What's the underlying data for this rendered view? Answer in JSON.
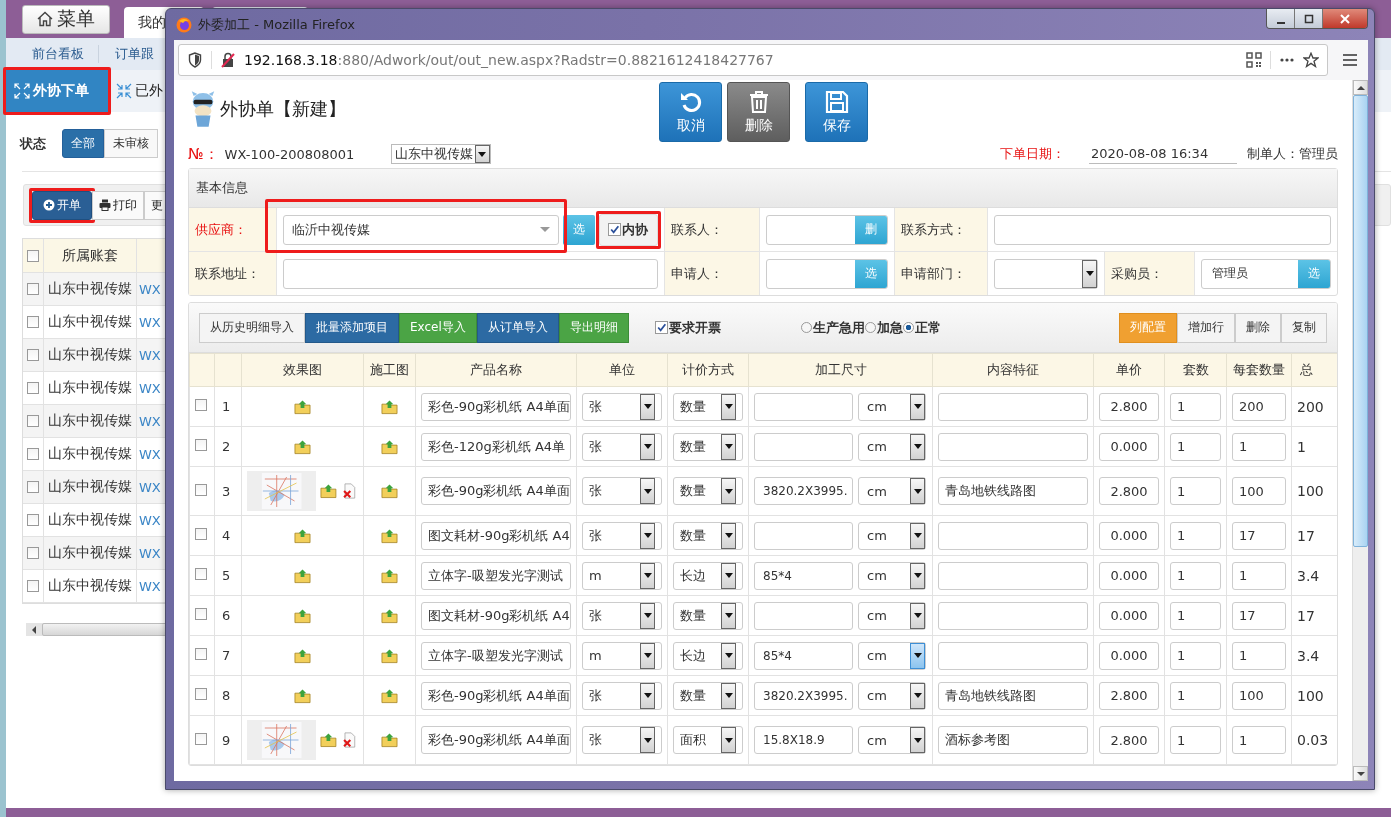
{
  "background_app": {
    "menu_button": "菜单",
    "tabs": [
      {
        "label": "我的",
        "selected": true
      }
    ],
    "nav": [
      "前台看板",
      "订单跟"
    ],
    "subtabs": [
      {
        "label": "外协下单",
        "kind": "expand",
        "selected": true,
        "highlighted": true
      },
      {
        "label": "已外",
        "kind": "collapse",
        "selected": false,
        "highlighted": false
      }
    ],
    "status_filter": {
      "label": "状态",
      "options": [
        {
          "label": "全部",
          "selected": true
        },
        {
          "label": "未审核",
          "selected": false
        }
      ]
    },
    "toolbar": [
      {
        "label": "开单",
        "kind": "add",
        "highlighted": true
      },
      {
        "label": "打印",
        "kind": "print",
        "highlighted": false
      },
      {
        "label": "更",
        "kind": "plain",
        "highlighted": false
      }
    ],
    "table": {
      "all_checked": false,
      "columns": [
        "所属账套"
      ],
      "rows": [
        {
          "checked": false,
          "account": "山东中视传媒",
          "number": "WX"
        },
        {
          "checked": false,
          "account": "山东中视传媒",
          "number": "WX"
        },
        {
          "checked": false,
          "account": "山东中视传媒",
          "number": "WX"
        },
        {
          "checked": false,
          "account": "山东中视传媒",
          "number": "WX"
        },
        {
          "checked": false,
          "account": "山东中视传媒",
          "number": "WX"
        },
        {
          "checked": false,
          "account": "山东中视传媒",
          "number": "WX"
        },
        {
          "checked": false,
          "account": "山东中视传媒",
          "number": "WX"
        },
        {
          "checked": false,
          "account": "山东中视传媒",
          "number": "WX"
        },
        {
          "checked": false,
          "account": "山东中视传媒",
          "number": "WX"
        },
        {
          "checked": false,
          "account": "山东中视传媒",
          "number": "WX"
        }
      ]
    }
  },
  "popup": {
    "window_title": "外委加工 - Mozilla Firefox",
    "url_host": "192.168.3.18",
    "url_rest": ":880/Adwork/out/out_new.aspx?Radstr=0.8821612418427767",
    "page_title": "外协单【新建】",
    "actions": [
      {
        "label": "取消",
        "kind": "cancel"
      },
      {
        "label": "删除",
        "kind": "delete"
      },
      {
        "label": "保存",
        "kind": "save"
      }
    ],
    "order_no_label": "№：",
    "order_no": "WX-100-200808001",
    "account_select": "山东中视传媒",
    "date_label": "下单日期：",
    "date": "2020-08-08 16:34",
    "creator": "制单人：管理员",
    "basic_info": {
      "title": "基本信息",
      "supplier_label": "供应商：",
      "supplier": "临沂中视传媒",
      "supplier_highlighted": true,
      "supplier_button": "选",
      "internal": {
        "label": "内协",
        "checked": true,
        "highlighted": true
      },
      "contact_label": "联系人：",
      "contact_button": "删",
      "contact_method_label": "联系方式：",
      "address_label": "联系地址：",
      "applicant_label": "申请人：",
      "applicant_button": "选",
      "dept_label": "申请部门：",
      "buyer_label": "采购员：",
      "buyer": "管理员",
      "buyer_button": "选"
    },
    "imports": [
      {
        "label": "从历史明细导入",
        "kind": "plain"
      },
      {
        "label": "批量添加项目",
        "kind": "blue"
      },
      {
        "label": "Excel导入",
        "kind": "green"
      },
      {
        "label": "从订单导入",
        "kind": "blue"
      },
      {
        "label": "导出明细",
        "kind": "green"
      }
    ],
    "invoice": {
      "label": "要求开票",
      "checked": true
    },
    "urgency": [
      {
        "label": "生产急用",
        "selected": false
      },
      {
        "label": "加急",
        "selected": false
      },
      {
        "label": "正常",
        "selected": true
      }
    ],
    "grid_actions": [
      {
        "label": "列配置",
        "kind": "orange"
      },
      {
        "label": "增加行",
        "kind": "plain"
      },
      {
        "label": "删除",
        "kind": "plain"
      },
      {
        "label": "复制",
        "kind": "plain"
      }
    ],
    "columns": [
      "效果图",
      "施工图",
      "产品名称",
      "单位",
      "计价方式",
      "加工尺寸",
      "内容特征",
      "单价",
      "套数",
      "每套数量",
      "总"
    ],
    "rows": [
      {
        "checked": false,
        "no": "1",
        "has_image": false,
        "name": "彩色-90g彩机纸 A4单面",
        "unit": "张",
        "pricing": "数量",
        "size_unit": "cm",
        "size_unit_focused": false,
        "price": "2.800",
        "sets": "1",
        "per_set": "200",
        "total": "200"
      },
      {
        "checked": false,
        "no": "2",
        "has_image": false,
        "name": "彩色-120g彩机纸 A4单",
        "unit": "张",
        "pricing": "数量",
        "size_unit": "cm",
        "size_unit_focused": false,
        "price": "0.000",
        "sets": "1",
        "per_set": "1",
        "total": "1"
      },
      {
        "checked": false,
        "no": "3",
        "has_image": true,
        "name": "彩色-90g彩机纸 A4单面",
        "unit": "张",
        "pricing": "数量",
        "size": "3820.2X3995.",
        "size_unit": "cm",
        "size_unit_focused": false,
        "feature": "青岛地铁线路图",
        "price": "2.800",
        "sets": "1",
        "per_set": "100",
        "total": "100"
      },
      {
        "checked": false,
        "no": "4",
        "has_image": false,
        "name": "图文耗材-90g彩机纸 A4",
        "unit": "张",
        "pricing": "数量",
        "size_unit": "cm",
        "size_unit_focused": false,
        "price": "0.000",
        "sets": "1",
        "per_set": "17",
        "total": "17"
      },
      {
        "checked": false,
        "no": "5",
        "has_image": false,
        "name": "立体字-吸塑发光字测试",
        "unit": "m",
        "pricing": "长边",
        "size": "85*4",
        "size_unit": "cm",
        "size_unit_focused": false,
        "price": "0.000",
        "sets": "1",
        "per_set": "1",
        "total": "3.4"
      },
      {
        "checked": false,
        "no": "6",
        "has_image": false,
        "name": "图文耗材-90g彩机纸 A4",
        "unit": "张",
        "pricing": "数量",
        "size_unit": "cm",
        "size_unit_focused": false,
        "price": "0.000",
        "sets": "1",
        "per_set": "17",
        "total": "17"
      },
      {
        "checked": false,
        "no": "7",
        "has_image": false,
        "name": "立体字-吸塑发光字测试",
        "unit": "m",
        "pricing": "长边",
        "size": "85*4",
        "size_unit": "cm",
        "size_unit_focused": true,
        "price": "0.000",
        "sets": "1",
        "per_set": "1",
        "total": "3.4"
      },
      {
        "checked": false,
        "no": "8",
        "has_image": false,
        "name": "彩色-90g彩机纸 A4单面",
        "unit": "张",
        "pricing": "数量",
        "size": "3820.2X3995.",
        "size_unit": "cm",
        "size_unit_focused": false,
        "feature": "青岛地铁线路图",
        "price": "2.800",
        "sets": "1",
        "per_set": "100",
        "total": "100"
      },
      {
        "checked": false,
        "no": "9",
        "has_image": true,
        "name": "彩色-90g彩机纸 A4单面",
        "unit": "张",
        "pricing": "面积",
        "size": "15.8X18.9",
        "size_unit": "cm",
        "size_unit_focused": false,
        "feature": "酒标参考图",
        "price": "2.800",
        "sets": "1",
        "per_set": "1",
        "total": "0.03"
      }
    ]
  }
}
